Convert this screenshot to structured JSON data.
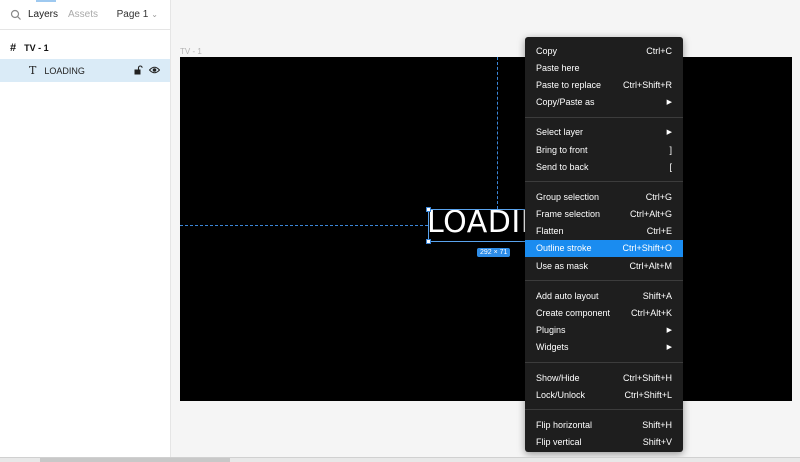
{
  "left_panel": {
    "tabs": {
      "layers": "Layers",
      "assets": "Assets"
    },
    "page": "Page 1",
    "layers": [
      {
        "label": "TV - 1",
        "type": "frame"
      },
      {
        "label": "LOADING",
        "type": "text"
      }
    ]
  },
  "canvas": {
    "frame_label": "TV - 1",
    "text": "LOADING",
    "size_badge": "292 × 71"
  },
  "context_menu": {
    "groups": [
      [
        {
          "label": "Copy",
          "shortcut": "Ctrl+C"
        },
        {
          "label": "Paste here",
          "shortcut": ""
        },
        {
          "label": "Paste to replace",
          "shortcut": "Ctrl+Shift+R"
        },
        {
          "label": "Copy/Paste as",
          "shortcut": "▶"
        }
      ],
      [
        {
          "label": "Select layer",
          "shortcut": "▶"
        },
        {
          "label": "Bring to front",
          "shortcut": "]"
        },
        {
          "label": "Send to back",
          "shortcut": "["
        }
      ],
      [
        {
          "label": "Group selection",
          "shortcut": "Ctrl+G"
        },
        {
          "label": "Frame selection",
          "shortcut": "Ctrl+Alt+G"
        },
        {
          "label": "Flatten",
          "shortcut": "Ctrl+E"
        },
        {
          "label": "Outline stroke",
          "shortcut": "Ctrl+Shift+O",
          "highlighted": true
        },
        {
          "label": "Use as mask",
          "shortcut": "Ctrl+Alt+M"
        }
      ],
      [
        {
          "label": "Add auto layout",
          "shortcut": "Shift+A"
        },
        {
          "label": "Create component",
          "shortcut": "Ctrl+Alt+K"
        },
        {
          "label": "Plugins",
          "shortcut": "▶"
        },
        {
          "label": "Widgets",
          "shortcut": "▶"
        }
      ],
      [
        {
          "label": "Show/Hide",
          "shortcut": "Ctrl+Shift+H"
        },
        {
          "label": "Lock/Unlock",
          "shortcut": "Ctrl+Shift+L"
        }
      ],
      [
        {
          "label": "Flip horizontal",
          "shortcut": "Shift+H"
        },
        {
          "label": "Flip vertical",
          "shortcut": "Shift+V"
        }
      ]
    ]
  },
  "colors": {
    "accent": "#1a8cf0",
    "selection": "#daebf7",
    "menu_bg": "#1e1e1e"
  }
}
